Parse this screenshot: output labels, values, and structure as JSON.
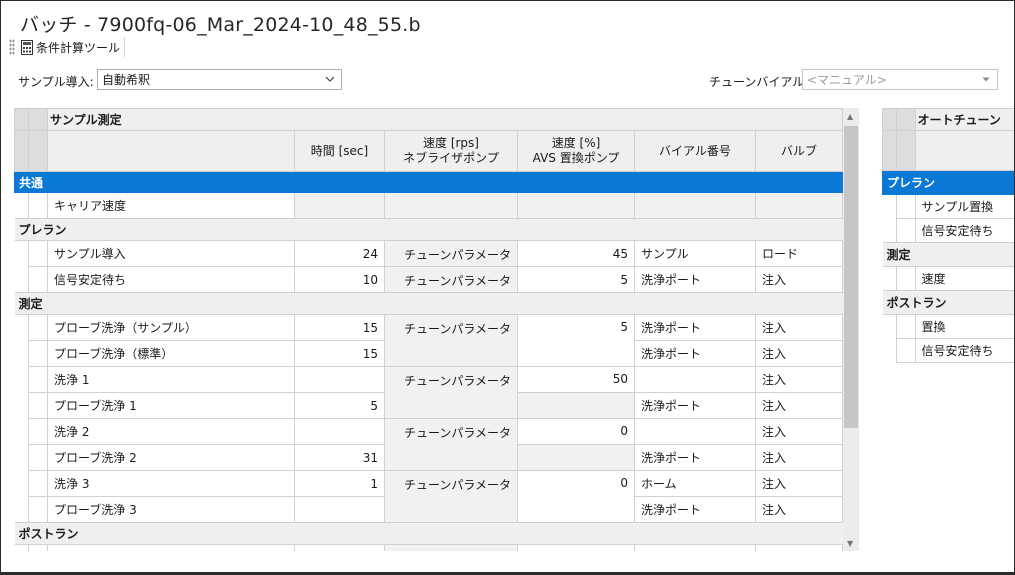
{
  "window": {
    "title": "バッチ - 7900fq-06_Mar_2024-10_48_55.b"
  },
  "toolbar": {
    "calc_tool_label": "条件計算ツール"
  },
  "sample_intro": {
    "label": "サンプル導入:",
    "value": "自動希釈"
  },
  "tune_vial": {
    "label": "チューンバイアル:",
    "value": "<マニュアル>"
  },
  "grid": {
    "group_header": "サンプル測定",
    "columns": [
      "時間 [sec]",
      "速度 [rps]",
      "ネブライザポンプ",
      "速度 [%]",
      "AVS 置換ポンプ",
      "バイアル番号",
      "バルブ"
    ],
    "sections": {
      "common": "共通",
      "prerun": "プレラン",
      "measure": "測定",
      "postrun": "ポストラン"
    },
    "rows": {
      "carrier": {
        "name": "キャリア速度"
      },
      "sample_intro": {
        "name": "サンプル導入",
        "time": "24",
        "neb": "チューンパラメータ",
        "avs": "45",
        "vial": "サンプル",
        "valve": "ロード"
      },
      "signal_wait": {
        "name": "信号安定待ち",
        "time": "10",
        "neb": "チューンパラメータ",
        "avs": "5",
        "vial": "洗浄ポート",
        "valve": "注入"
      },
      "probe_wash_sample": {
        "name": "プローブ洗浄（サンプル）",
        "time": "15",
        "neb": "チューンパラメータ",
        "avs": "5",
        "vial": "洗浄ポート",
        "valve": "注入"
      },
      "probe_wash_std": {
        "name": "プローブ洗浄（標準）",
        "time": "15",
        "vial": "洗浄ポート",
        "valve": "注入"
      },
      "wash1": {
        "name": "洗浄 1",
        "neb": "チューンパラメータ",
        "avs": "50",
        "valve": "注入"
      },
      "probe_wash1": {
        "name": "プローブ洗浄 1",
        "time": "5",
        "vial": "洗浄ポート",
        "valve": "注入"
      },
      "wash2": {
        "name": "洗浄 2",
        "neb": "チューンパラメータ",
        "avs": "0",
        "valve": "注入"
      },
      "probe_wash2": {
        "name": "プローブ洗浄 2",
        "time": "31",
        "vial": "洗浄ポート",
        "valve": "注入"
      },
      "wash3": {
        "name": "洗浄 3",
        "time": "1",
        "neb": "チューンパラメータ",
        "avs": "0",
        "vial": "ホーム",
        "valve": "注入"
      },
      "probe_wash3": {
        "name": "プローブ洗浄 3",
        "vial": "洗浄ポート",
        "valve": "注入"
      }
    }
  },
  "right_grid": {
    "group_header": "オートチューン",
    "sections": {
      "prerun": "プレラン",
      "measure": "測定",
      "postrun": "ポストラン"
    },
    "rows": {
      "sample_replace": "サンプル置換",
      "signal_wait": "信号安定待ち",
      "speed": "速度",
      "replace": "置換",
      "signal_wait2": "信号安定待ち"
    }
  }
}
